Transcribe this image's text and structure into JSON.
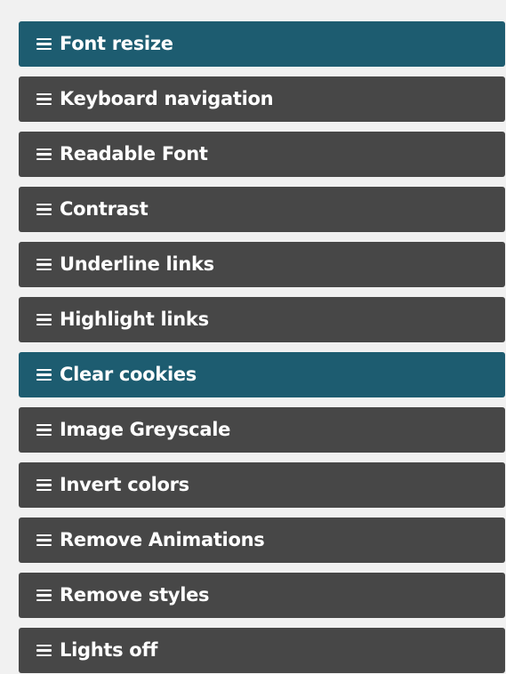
{
  "colors": {
    "page_background": "#f1f1f1",
    "item_background": "#474747",
    "item_active_background": "#1d5c70",
    "item_text": "#ffffff"
  },
  "menu": {
    "icon": "hamburger-icon",
    "items": [
      {
        "label": "Font resize",
        "highlighted": true
      },
      {
        "label": "Keyboard navigation",
        "highlighted": false
      },
      {
        "label": "Readable Font",
        "highlighted": false
      },
      {
        "label": "Contrast",
        "highlighted": false
      },
      {
        "label": "Underline links",
        "highlighted": false
      },
      {
        "label": "Highlight links",
        "highlighted": false
      },
      {
        "label": "Clear cookies",
        "highlighted": true
      },
      {
        "label": "Image Greyscale",
        "highlighted": false
      },
      {
        "label": "Invert colors",
        "highlighted": false
      },
      {
        "label": "Remove Animations",
        "highlighted": false
      },
      {
        "label": "Remove styles",
        "highlighted": false
      },
      {
        "label": "Lights off",
        "highlighted": false
      }
    ]
  }
}
